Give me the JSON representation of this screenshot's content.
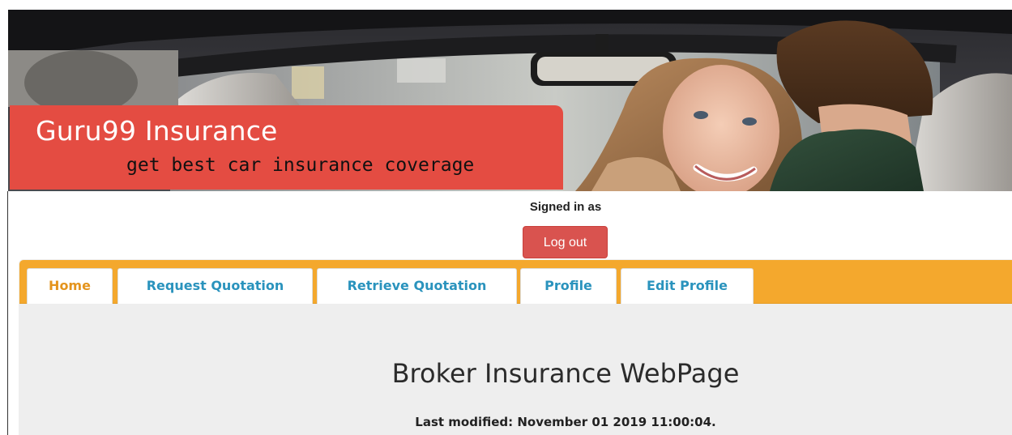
{
  "header": {
    "brand_title": "Guru99 Insurance",
    "brand_tagline": "get best car insurance coverage"
  },
  "session": {
    "signed_in_label": "Signed in as",
    "logout_label": "Log out"
  },
  "nav": {
    "tabs": [
      {
        "label": "Home",
        "active": true
      },
      {
        "label": "Request Quotation",
        "active": false
      },
      {
        "label": "Retrieve Quotation",
        "active": false
      },
      {
        "label": "Profile",
        "active": false
      },
      {
        "label": "Edit Profile",
        "active": false
      }
    ]
  },
  "main": {
    "title": "Broker Insurance WebPage",
    "last_modified": "Last modified: November 01 2019 11:00:04."
  },
  "colors": {
    "brand_red": "#e44c42",
    "tab_bar_orange": "#f4a82d",
    "tab_link_blue": "#2a93bd",
    "tab_active_orange": "#e4941d",
    "logout_red": "#d9534f",
    "panel_gray": "#eeeeee"
  }
}
